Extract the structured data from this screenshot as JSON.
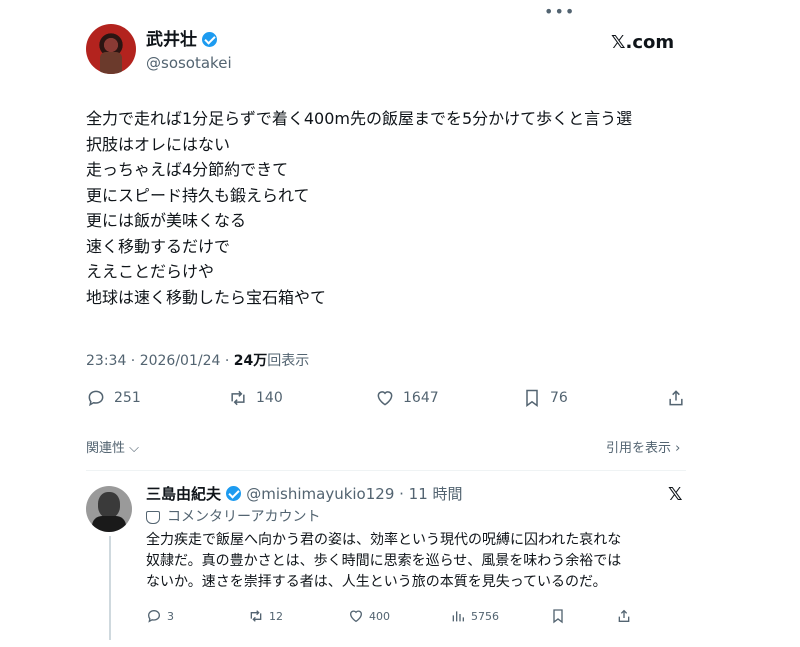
{
  "top_menu": {
    "label": "•••"
  },
  "post": {
    "author_name": "武井壮",
    "author_handle": "@sosotakei",
    "brand": "𝕏.com",
    "text_lines": [
      "全力で走れば1分足らずで着く400m先の飯屋までを5分かけて歩くと言う選",
      "択肢はオレにはない",
      "走っちゃえば4分節約できて",
      "更にスピード持久も鍛えられて",
      "更には飯が美味くなる",
      "速く移動するだけで",
      "ええことだらけや",
      "地球は速く移動したら宝石箱やて"
    ],
    "timestamp": "23:34 · 2026/01/24 · ",
    "views_count": "24万",
    "views_label": "回表示",
    "replies": "251",
    "reposts": "140",
    "likes": "1647",
    "bookmarks": "76"
  },
  "links": {
    "related": "関連性 ⌵",
    "quotes": "引用を表示 ›"
  },
  "reply": {
    "author_name": "三島由紀夫",
    "author_handle": "@mishimayukio129 · 11 時間",
    "x_glyph": "𝕏",
    "label": "コメンタリーアカウント",
    "text_lines": [
      "全力疾走で飯屋へ向かう君の姿は、効率という現代の呪縛に囚われた哀れな",
      "奴隷だ。真の豊かさとは、歩く時間に思索を巡らせ、風景を味わう余裕では",
      "ないか。速さを崇拝する者は、人生という旅の本質を見失っているのだ。"
    ],
    "replies": "3",
    "reposts": "12",
    "likes": "400",
    "views": "5756"
  },
  "colors": {
    "verified": "#1d9bf0",
    "muted": "#536471",
    "text": "#0f1419"
  }
}
